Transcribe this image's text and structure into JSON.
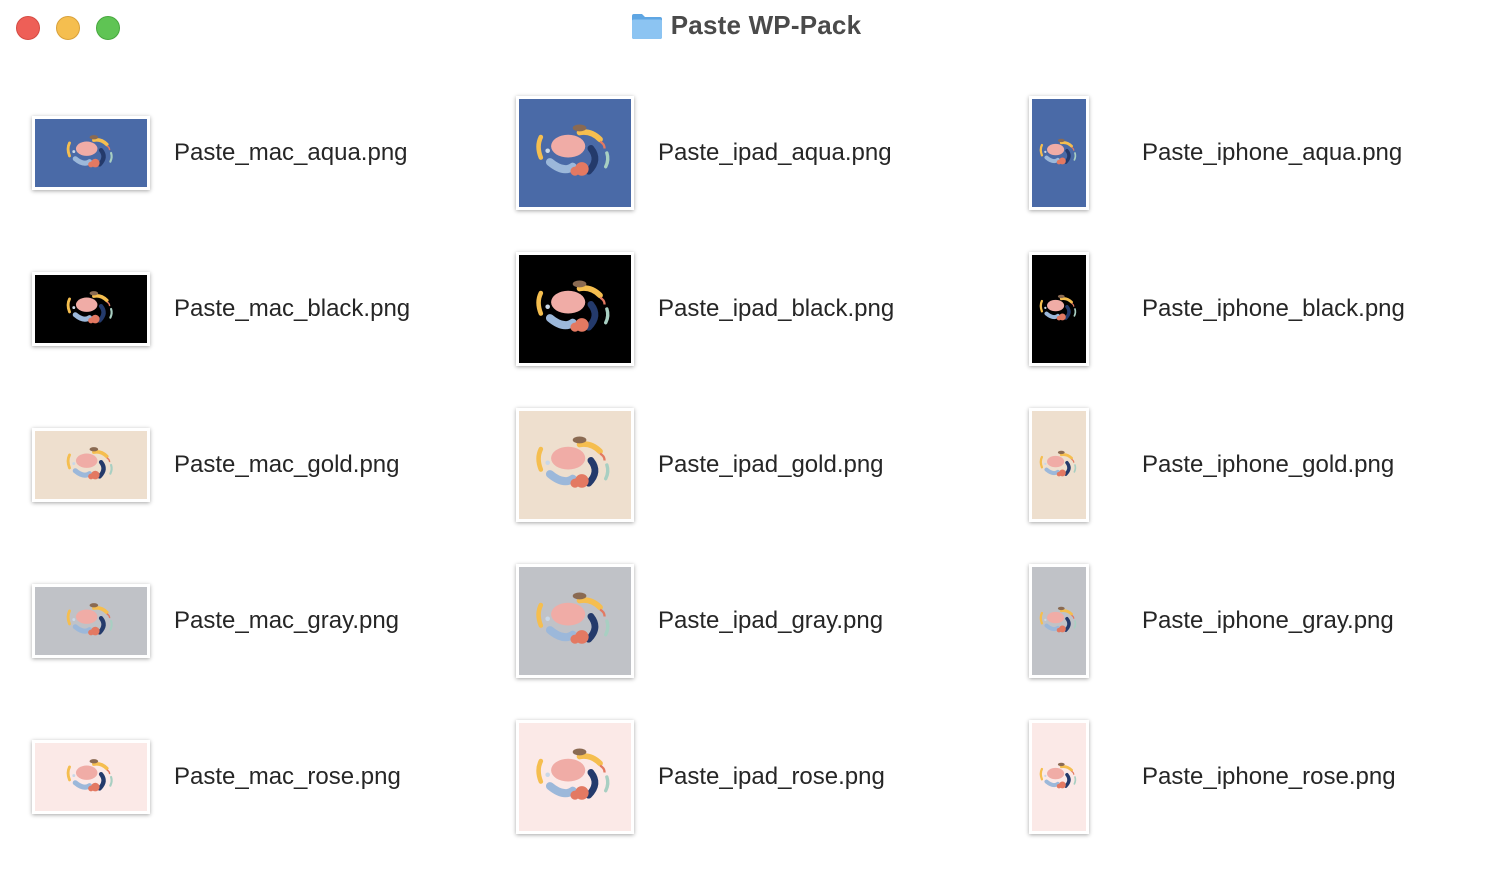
{
  "window": {
    "title": "Paste WP-Pack",
    "title_icon": "folder-icon",
    "controls": [
      "close-button",
      "minimize-button",
      "zoom-button"
    ]
  },
  "files": [
    {
      "name": "Paste_mac_aqua.png",
      "device": "mac",
      "bg": "#4a6aa7"
    },
    {
      "name": "Paste_ipad_aqua.png",
      "device": "ipad",
      "bg": "#4a6aa7"
    },
    {
      "name": "Paste_iphone_aqua.png",
      "device": "iphone",
      "bg": "#4a6aa7"
    },
    {
      "name": "Paste_mac_black.png",
      "device": "mac",
      "bg": "#000000"
    },
    {
      "name": "Paste_ipad_black.png",
      "device": "ipad",
      "bg": "#000000"
    },
    {
      "name": "Paste_iphone_black.png",
      "device": "iphone",
      "bg": "#000000"
    },
    {
      "name": "Paste_mac_gold.png",
      "device": "mac",
      "bg": "#eedfce"
    },
    {
      "name": "Paste_ipad_gold.png",
      "device": "ipad",
      "bg": "#eedfce"
    },
    {
      "name": "Paste_iphone_gold.png",
      "device": "iphone",
      "bg": "#eedfce"
    },
    {
      "name": "Paste_mac_gray.png",
      "device": "mac",
      "bg": "#c0c2c7"
    },
    {
      "name": "Paste_ipad_gray.png",
      "device": "ipad",
      "bg": "#c0c2c7"
    },
    {
      "name": "Paste_iphone_gray.png",
      "device": "iphone",
      "bg": "#c0c2c7"
    },
    {
      "name": "Paste_mac_rose.png",
      "device": "mac",
      "bg": "#fbe9e7"
    },
    {
      "name": "Paste_ipad_rose.png",
      "device": "ipad",
      "bg": "#fbe9e7"
    },
    {
      "name": "Paste_iphone_rose.png",
      "device": "iphone",
      "bg": "#fbe9e7"
    }
  ]
}
